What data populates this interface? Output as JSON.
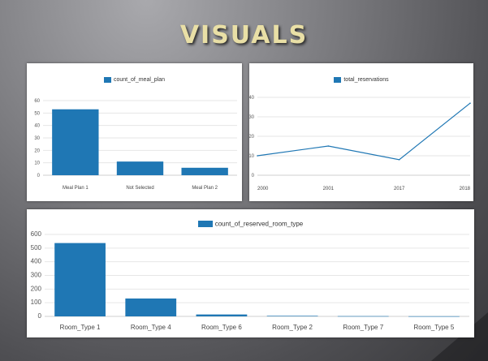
{
  "title": "VISUALS",
  "colors": {
    "series": "#1f77b4",
    "grid": "#e6e6e6",
    "title": "#e9dfa6"
  },
  "chart_data": [
    {
      "type": "bar",
      "series": [
        {
          "name": "count_of_meal_plan",
          "values": [
            53,
            11,
            6
          ]
        }
      ],
      "categories": [
        "Meal Plan 1",
        "Not Selected",
        "Meal Plan 2"
      ],
      "yticks": [
        "0",
        "10",
        "20",
        "30",
        "40",
        "50",
        "60"
      ],
      "ylim": [
        0,
        60
      ],
      "grid": true,
      "legend": "top-center"
    },
    {
      "type": "line",
      "series": [
        {
          "name": "total_reservations",
          "values": [
            10,
            15,
            8,
            37
          ]
        }
      ],
      "categories": [
        "2000",
        "2001",
        "2017",
        "2018"
      ],
      "yticks": [
        "0",
        "10",
        "20",
        "30",
        "40"
      ],
      "ylim": [
        0,
        40
      ],
      "grid": true,
      "legend": "top-center"
    },
    {
      "type": "bar",
      "series": [
        {
          "name": "count_of_reserved_room_type",
          "values": [
            537,
            131,
            14,
            4,
            2,
            1
          ]
        }
      ],
      "categories": [
        "Room_Type 1",
        "Room_Type 4",
        "Room_Type 6",
        "Room_Type 2",
        "Room_Type 7",
        "Room_Type 5"
      ],
      "yticks": [
        "0",
        "100",
        "200",
        "300",
        "400",
        "500",
        "600"
      ],
      "ylim": [
        0,
        600
      ],
      "grid": true,
      "legend": "top-center"
    }
  ]
}
